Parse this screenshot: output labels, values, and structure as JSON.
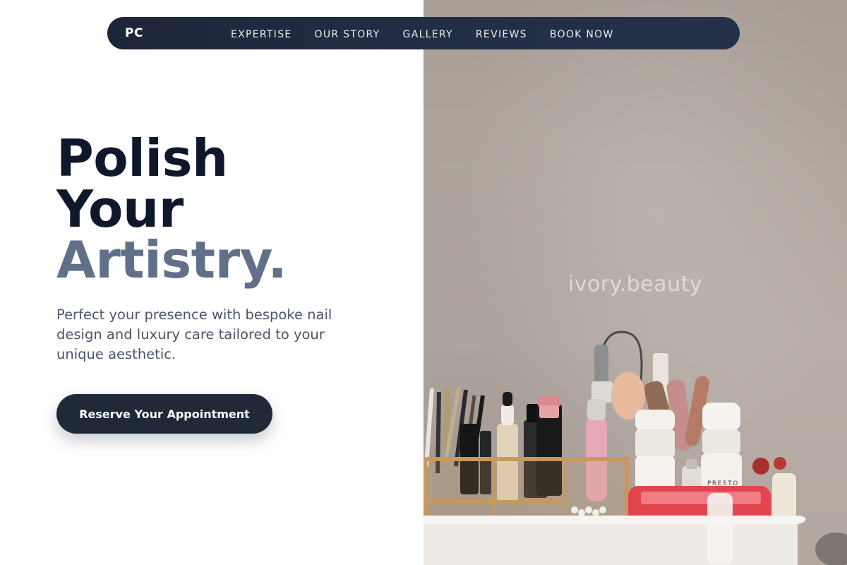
{
  "nav": {
    "logo": "PC",
    "links": [
      "EXPERTISE",
      "OUR STORY",
      "GALLERY",
      "REVIEWS",
      "BOOK NOW"
    ]
  },
  "hero": {
    "headline": {
      "line1": "Polish",
      "line2": "Your",
      "line3": "Artistry."
    },
    "subtitle": "Perfect your presence with bespoke nail design and luxury care tailored to your unique aesthetic.",
    "cta_label": "Reserve Your Appointment"
  },
  "image": {
    "watermark": "ivory.beauty",
    "subject": "nail-care-products-organizer-photo"
  },
  "colors": {
    "nav_bg": "#1d2638",
    "headline_dark": "#0f172a",
    "headline_muted": "#617089",
    "body_text": "#4a5568",
    "cta_bg": "#1f2937",
    "photo_bg": "#b1a79f"
  }
}
